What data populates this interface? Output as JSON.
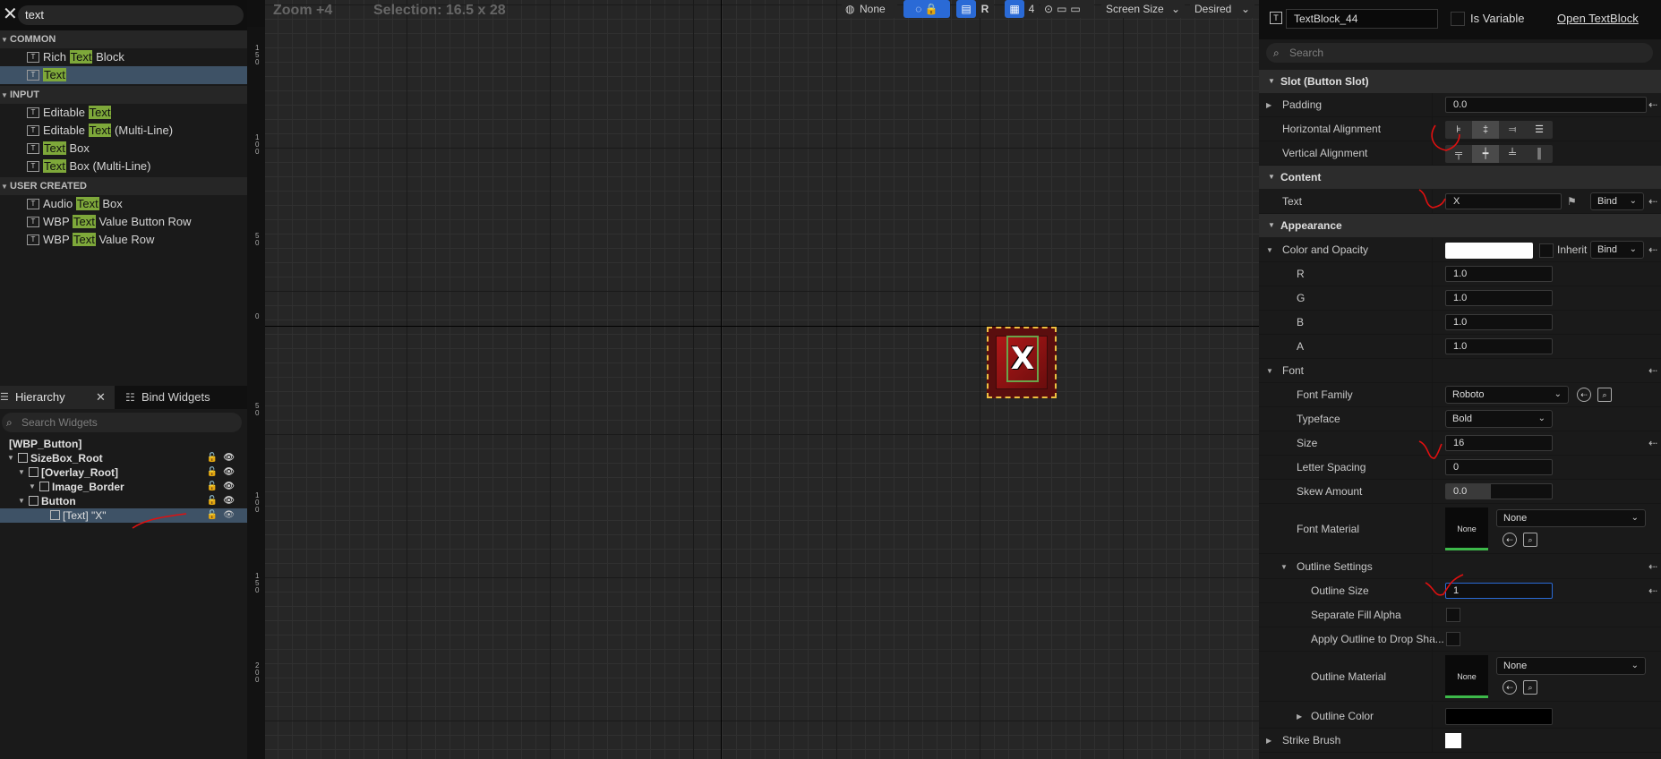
{
  "palette": {
    "search_value": "text",
    "categories": [
      {
        "label": "COMMON",
        "items": [
          {
            "pre": "Rich ",
            "hl": "Text",
            "post": " Block",
            "icon": "rich-text-icon"
          },
          {
            "pre": "",
            "hl": "Text",
            "post": "",
            "icon": "text-icon"
          }
        ]
      },
      {
        "label": "INPUT",
        "items": [
          {
            "pre": "Editable ",
            "hl": "Text",
            "post": "",
            "icon": "editable-text-icon"
          },
          {
            "pre": "Editable ",
            "hl": "Text",
            "post": " (Multi-Line)",
            "icon": "editable-text-multiline-icon"
          },
          {
            "pre": "",
            "hl": "Text",
            "post": " Box",
            "icon": "text-box-icon"
          },
          {
            "pre": "",
            "hl": "Text",
            "post": " Box (Multi-Line)",
            "icon": "text-box-multiline-icon"
          }
        ]
      },
      {
        "label": "USER CREATED",
        "items": [
          {
            "pre": "Audio ",
            "hl": "Text",
            "post": " Box",
            "icon": "user-widget-icon"
          },
          {
            "pre": "WBP ",
            "hl": "Text",
            "post": " Value Button Row",
            "icon": "user-widget-icon"
          },
          {
            "pre": "WBP ",
            "hl": "Text",
            "post": " Value Row",
            "icon": "user-widget-icon"
          }
        ]
      }
    ]
  },
  "hierarchy": {
    "tab_label": "Hierarchy",
    "bind_tab_label": "Bind Widgets",
    "search_placeholder": "Search Widgets",
    "rows": [
      {
        "label": "[WBP_Button]"
      },
      {
        "label": "SizeBox_Root"
      },
      {
        "label": "[Overlay_Root]"
      },
      {
        "label": "Image_Border"
      },
      {
        "label": "Button"
      },
      {
        "label": "[Text] \"X\""
      }
    ]
  },
  "viewport": {
    "zoom": "Zoom +4",
    "selection": "Selection: 16.5 x 28",
    "toolbar": {
      "none_label": "None",
      "r_label": "R",
      "grid_value": "4",
      "screen_size": "Screen Size",
      "desired": "Desired"
    },
    "widget_text": "X",
    "ruler_labels": [
      "150",
      "100",
      "50",
      "0",
      "50",
      "100",
      "150",
      "200"
    ]
  },
  "details": {
    "widget_name": "TextBlock_44",
    "is_variable_label": "Is Variable",
    "open_label": "Open TextBlock",
    "search_placeholder": "Search",
    "slot_section": "Slot (Button Slot)",
    "padding_label": "Padding",
    "padding_value": "0.0",
    "halign_label": "Horizontal Alignment",
    "valign_label": "Vertical Alignment",
    "content_section": "Content",
    "text_label": "Text",
    "text_value": "X",
    "bind_label": "Bind",
    "appearance_section": "Appearance",
    "color_label": "Color and Opacity",
    "inherit_label": "Inherit",
    "r_label": "R",
    "r_value": "1.0",
    "g_label": "G",
    "g_value": "1.0",
    "b_label": "B",
    "b_value": "1.0",
    "a_label": "A",
    "a_value": "1.0",
    "font_label": "Font",
    "font_family_label": "Font Family",
    "font_family_value": "Roboto",
    "typeface_label": "Typeface",
    "typeface_value": "Bold",
    "size_label": "Size",
    "size_value": "16",
    "letter_spacing_label": "Letter Spacing",
    "letter_spacing_value": "0",
    "skew_label": "Skew Amount",
    "skew_value": "0.0",
    "font_material_label": "Font Material",
    "none_thumb": "None",
    "none_dd": "None",
    "outline_settings_label": "Outline Settings",
    "outline_size_label": "Outline Size",
    "outline_size_value": "1",
    "sep_fill_label": "Separate Fill Alpha",
    "apply_outline_label": "Apply Outline to Drop Sha...",
    "outline_material_label": "Outline Material",
    "outline_color_label": "Outline Color",
    "strike_brush_label": "Strike Brush",
    "colors": {
      "color_opacity": "#ffffff",
      "outline_color": "#000000",
      "strike": "#ffffff"
    }
  }
}
